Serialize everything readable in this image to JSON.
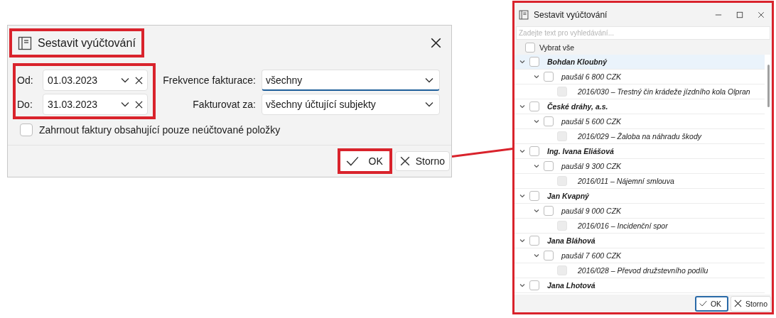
{
  "dialog": {
    "title": "Sestavit vyúčtování",
    "date_from": {
      "label": "Od:",
      "value": "01.03.2023"
    },
    "date_to": {
      "label": "Do:",
      "value": "31.03.2023"
    },
    "frequency": {
      "label": "Frekvence fakturace:",
      "value": "všechny",
      "focused": true
    },
    "bill_for": {
      "label": "Fakturovat za:",
      "value": "všechny účtující subjekty",
      "focused": false
    },
    "unbilled_only": {
      "label": "Zahrnout faktury obsahující pouze neúčtované položky",
      "checked": false
    },
    "buttons": [
      {
        "label": "OK",
        "kind": "ok"
      },
      {
        "label": "Storno",
        "kind": "cancel"
      }
    ]
  },
  "preview_window": {
    "title": "Sestavit vyúčtování",
    "search": {
      "placeholder": "Zadejte text pro vyhledávání..."
    },
    "select_all": {
      "label": "Vybrat vše",
      "checked": false
    },
    "tree": [
      {
        "label": "Bohdan Kloubný",
        "expanded": true,
        "checked": false,
        "selected": true,
        "children": [
          {
            "label": "paušál 6 800 CZK",
            "expanded": true,
            "checked": false,
            "children": [
              {
                "label": "2016/030 – Trestný čin krádeže jízdního kola Olpran",
                "checked": false,
                "disabled": true
              }
            ]
          }
        ]
      },
      {
        "label": "České dráhy, a.s.",
        "expanded": true,
        "checked": false,
        "selected": false,
        "children": [
          {
            "label": "paušál 5 600 CZK",
            "expanded": true,
            "checked": false,
            "children": [
              {
                "label": "2016/029 – Žaloba na náhradu škody",
                "checked": false,
                "disabled": true
              }
            ]
          }
        ]
      },
      {
        "label": "Ing. Ivana Eliášová",
        "expanded": true,
        "checked": false,
        "selected": false,
        "children": [
          {
            "label": "paušál 9 300 CZK",
            "expanded": true,
            "checked": false,
            "children": [
              {
                "label": "2016/011 – Nájemní smlouva",
                "checked": false,
                "disabled": true
              }
            ]
          }
        ]
      },
      {
        "label": "Jan Kvapný",
        "expanded": true,
        "checked": false,
        "selected": false,
        "children": [
          {
            "label": "paušál 9 000 CZK",
            "expanded": true,
            "checked": false,
            "children": [
              {
                "label": "2016/016 – Incidenční spor",
                "checked": false,
                "disabled": true
              }
            ]
          }
        ]
      },
      {
        "label": "Jana Bláhová",
        "expanded": true,
        "checked": false,
        "selected": false,
        "children": [
          {
            "label": "paušál 7 600 CZK",
            "expanded": true,
            "checked": false,
            "children": [
              {
                "label": "2016/028 – Převod družstevního podílu",
                "checked": false,
                "disabled": true
              }
            ]
          }
        ]
      },
      {
        "label": "Jana Lhotová",
        "expanded": true,
        "checked": false,
        "selected": false
      }
    ],
    "buttons": [
      {
        "label": "OK",
        "kind": "ok"
      },
      {
        "label": "Storno",
        "kind": "cancel"
      }
    ]
  }
}
